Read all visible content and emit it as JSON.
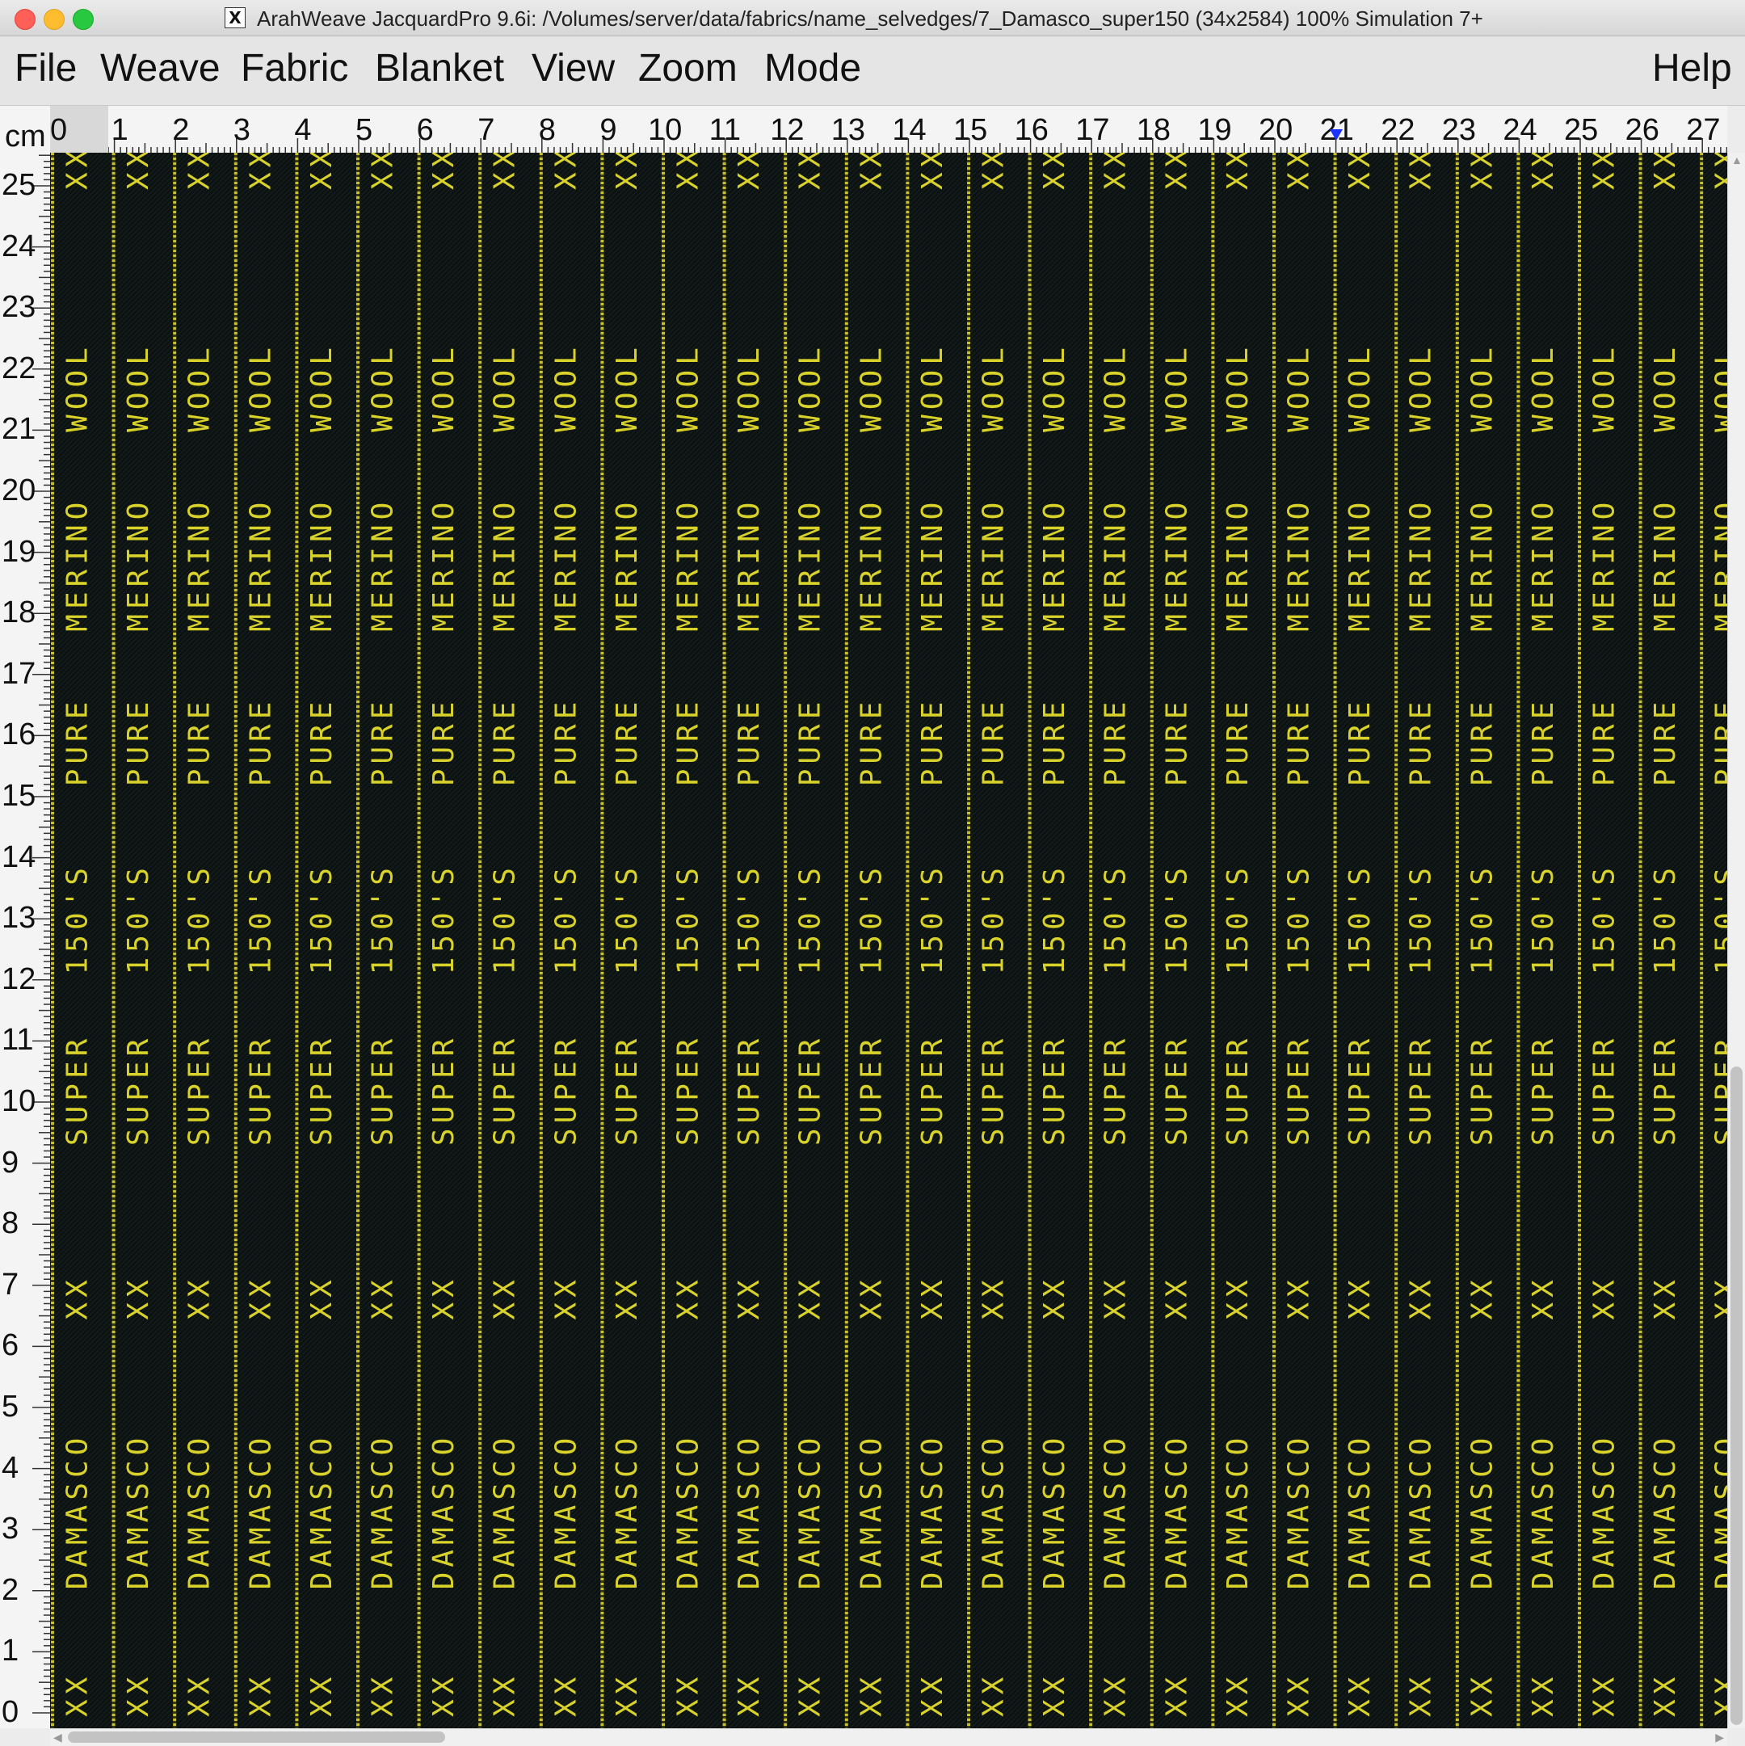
{
  "window": {
    "title": "ArahWeave JacquardPro 9.6i: /Volumes/server/data/fabrics/name_selvedges/7_Damasco_super150 (34x2584) 100% Simulation 7+",
    "x_glyph": "X"
  },
  "menu": {
    "items": [
      "File",
      "Weave",
      "Fabric",
      "Blanket",
      "View",
      "Zoom",
      "Mode"
    ],
    "help": "Help"
  },
  "ruler": {
    "unit": "cm",
    "x_labels": [
      "0",
      "1",
      "2",
      "3",
      "4",
      "5",
      "6",
      "7",
      "8",
      "9",
      "10",
      "11",
      "12",
      "13",
      "14",
      "15",
      "16",
      "17",
      "18",
      "19",
      "20",
      "21",
      "22",
      "23",
      "24",
      "25",
      "26",
      "27"
    ],
    "y_labels": [
      "0",
      "1",
      "2",
      "3",
      "4",
      "5",
      "6",
      "7",
      "8",
      "9",
      "10",
      "11",
      "12",
      "13",
      "14",
      "15",
      "16",
      "17",
      "18",
      "19",
      "20",
      "21",
      "22",
      "23",
      "24",
      "25"
    ],
    "marker_x_cm": 21
  },
  "fabric": {
    "column_count": 28,
    "words": [
      "XX",
      "WOOL",
      "MERINO",
      "PURE",
      "150'S",
      "SUPER",
      "XX",
      "DAMASCO",
      "XX"
    ],
    "word_centers_cm": [
      25.3,
      21.7,
      18.8,
      15.9,
      13.0,
      10.2,
      6.8,
      3.3,
      0.3
    ],
    "colors": {
      "background": "#0b1211",
      "text": "#d8d22a",
      "stripe": "#b7b52a"
    }
  },
  "scroll": {
    "vertical_thumb_start": 0.58,
    "vertical_thumb_end": 1.0,
    "horizontal_thumb_start": 0.0,
    "horizontal_thumb_end": 0.225
  }
}
